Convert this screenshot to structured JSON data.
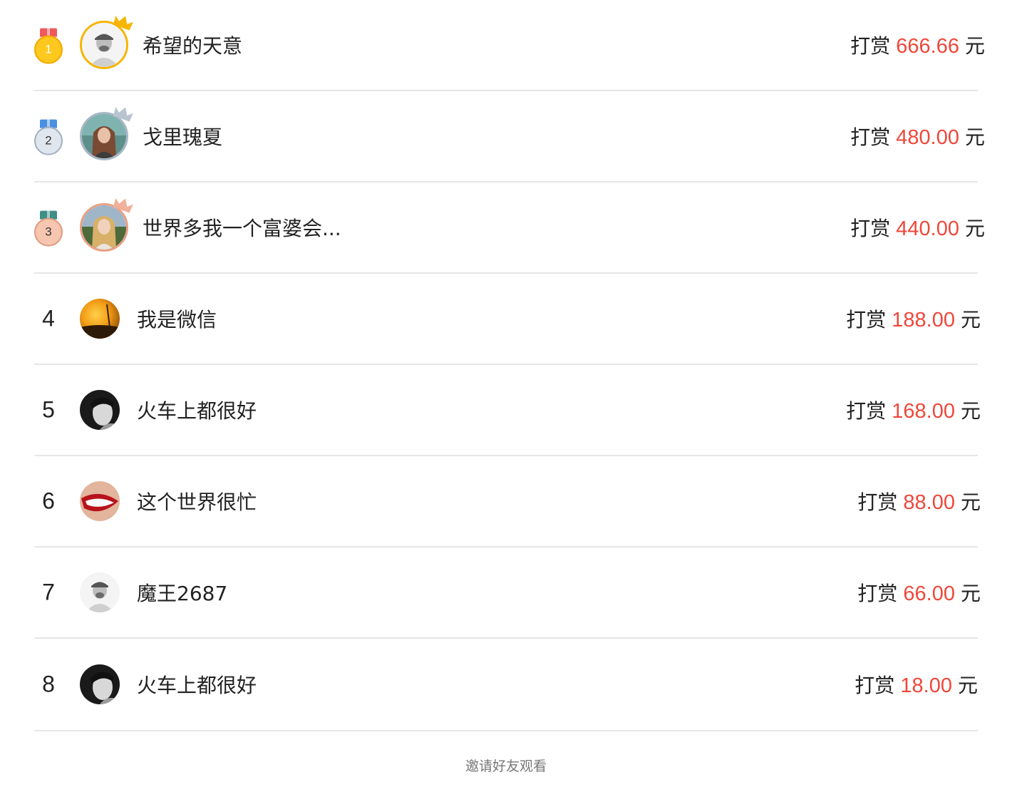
{
  "ranking": {
    "rows": [
      {
        "rank": "1",
        "name": "希望的天意",
        "reward_prefix": "打赏",
        "amount": "666.66",
        "unit": "元"
      },
      {
        "rank": "2",
        "name": "戈里瑰夏",
        "reward_prefix": "打赏",
        "amount": "480.00",
        "unit": "元"
      },
      {
        "rank": "3",
        "name": "世界多我一个富婆会...",
        "reward_prefix": "打赏",
        "amount": "440.00",
        "unit": "元"
      },
      {
        "rank": "4",
        "name": "我是微信",
        "reward_prefix": "打赏",
        "amount": "188.00",
        "unit": "元"
      },
      {
        "rank": "5",
        "name": "火车上都很好",
        "reward_prefix": "打赏",
        "amount": "168.00",
        "unit": "元"
      },
      {
        "rank": "6",
        "name": "这个世界很忙",
        "reward_prefix": "打赏",
        "amount": "88.00",
        "unit": "元"
      },
      {
        "rank": "7",
        "name": "魔王2687",
        "reward_prefix": "打赏",
        "amount": "66.00",
        "unit": "元"
      },
      {
        "rank": "8",
        "name": "火车上都很好",
        "reward_prefix": "打赏",
        "amount": "18.00",
        "unit": "元"
      }
    ]
  },
  "medal_colors": {
    "gold": "#f7b500",
    "silver": "#a9b7c6",
    "bronze": "#e8a085"
  },
  "amount_color": "#f0473a",
  "footer": {
    "invite_text": "邀请好友观看"
  }
}
